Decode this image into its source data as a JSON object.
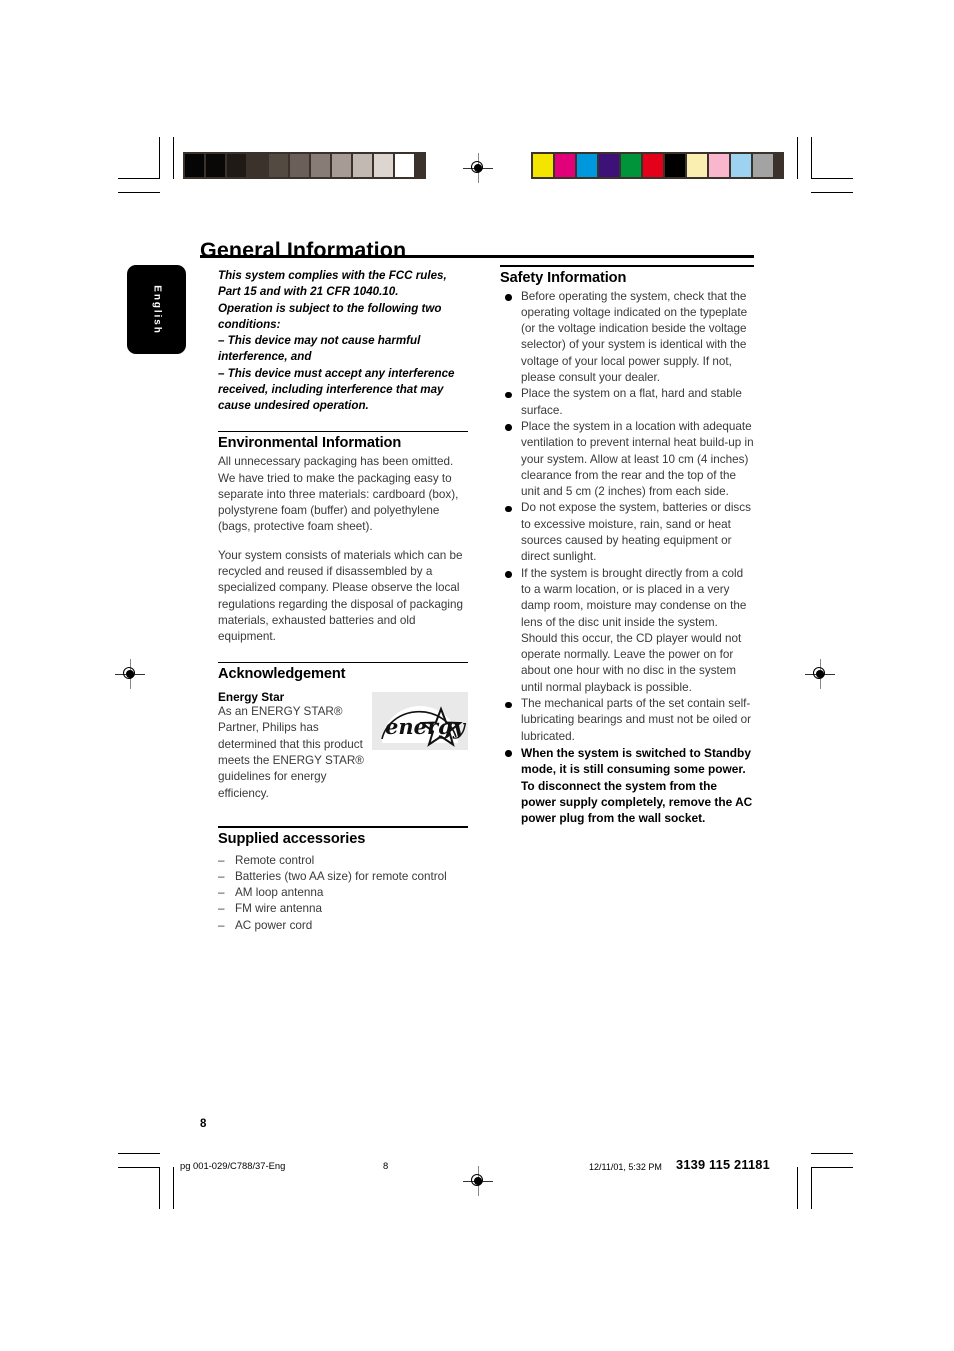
{
  "document": {
    "title": "General Information",
    "language_tab": "English",
    "page_number": "8"
  },
  "left_column": {
    "fcc_notice": [
      "This system complies with the FCC rules,",
      "Part 15 and with 21 CFR 1040.10.",
      "Operation is subject to the following two",
      "conditions:"
    ],
    "fcc_conditions": [
      "–  This device may not cause harmful interference, and",
      "–  This device must accept any interference received, including interference that may cause undesired operation."
    ],
    "environmental": {
      "heading": "Environmental Information",
      "paragraphs": [
        "All unnecessary packaging has been omitted. We have tried to make the packaging easy to separate into three materials: cardboard (box), polystyrene foam (buffer) and polyethylene (bags, protective foam sheet).",
        "Your system consists of materials which can be recycled and reused if disassembled by a specialized company. Please observe the local regulations regarding the disposal of packaging materials, exhausted batteries and old equipment."
      ]
    },
    "acknowledgement": {
      "heading": "Acknowledgement",
      "subheading": "Energy Star",
      "text": "As an ENERGY STAR® Partner, Philips has determined that this product meets the ENERGY STAR® guidelines for energy efficiency.",
      "logo_label": "energy"
    },
    "supplied_accessories": {
      "heading": "Supplied accessories",
      "items": [
        "Remote control",
        "Batteries (two AA size) for remote control",
        "AM loop antenna",
        "FM wire antenna",
        "AC power cord"
      ]
    }
  },
  "right_column": {
    "safety": {
      "heading": "Safety Information",
      "bullets": [
        {
          "text": "Before operating the system, check that the operating voltage indicated on the typeplate (or the voltage indication beside the voltage selector) of your system is identical with the voltage of your local power supply. If not, please consult your dealer.",
          "bold": false
        },
        {
          "text": "Place the system on a flat, hard and stable surface.",
          "bold": false
        },
        {
          "text": "Place the system in a location with adequate ventilation to prevent internal heat build-up in your system.  Allow at least 10 cm (4 inches) clearance from the rear and the top of the unit and 5 cm (2 inches) from each side.",
          "bold": false
        },
        {
          "text": "Do not expose the system, batteries or discs to excessive moisture, rain, sand or heat sources caused by heating equipment or direct sunlight.",
          "bold": false
        },
        {
          "text": "If the system is brought directly from a cold to a warm location, or is placed in a very damp room, moisture may condense on the lens of the disc unit inside the system. Should this occur, the CD player would not operate normally. Leave the power on for about one hour with no disc in the system until normal playback is possible.",
          "bold": false
        },
        {
          "text": "The mechanical parts of the set contain self-lubricating bearings and must not be oiled or lubricated.",
          "bold": false
        },
        {
          "text": "When the system is switched to Standby mode, it is still consuming some power. To disconnect the system from the power supply completely, remove the AC power plug from the wall socket.",
          "bold": true
        }
      ]
    }
  },
  "footer": {
    "file_name": "pg 001-029/C788/37-Eng",
    "page": "8",
    "timestamp": "12/11/01, 5:32 PM",
    "code": "3139 115 21181"
  },
  "print_marks": {
    "grayscale_patches": [
      "#050505",
      "#0a0806",
      "#1f1a16",
      "#3a322b",
      "#534a42",
      "#6b6059",
      "#887d76",
      "#a79c95",
      "#c2b9b2",
      "#ddd6d0",
      "#ffffff"
    ],
    "color_patches": [
      "#f3e500",
      "#e2007a",
      "#0098dc",
      "#3d1278",
      "#00943a",
      "#e2001a",
      "#000000",
      "#faeeb1",
      "#f9b6cd",
      "#9dd3f0",
      "#a3a3a3"
    ]
  }
}
